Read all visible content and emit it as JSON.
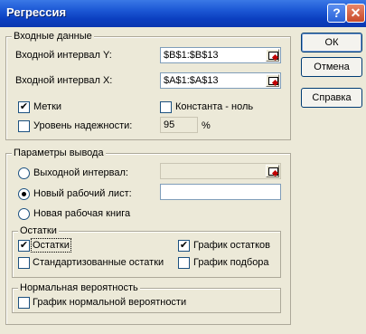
{
  "window": {
    "title": "Регрессия",
    "help_icon": "?",
    "close_icon": "✕"
  },
  "input_group": {
    "title": "Входные данные",
    "y_range_label": "Входной интервал Y:",
    "y_range_value": "$B$1:$B$13",
    "x_range_label": "Входной интервал X:",
    "x_range_value": "$A$1:$A$13",
    "labels_label": "Метки",
    "labels_checked": "✔",
    "constant_zero_label": "Константа - ноль",
    "confidence_label": "Уровень надежности:",
    "confidence_value": "95",
    "percent_sign": "%"
  },
  "output_group": {
    "title": "Параметры вывода",
    "output_range_label": "Выходной интервал:",
    "new_sheet_label": "Новый рабочий лист:",
    "new_workbook_label": "Новая рабочая книга"
  },
  "residuals_group": {
    "title": "Остатки",
    "residuals_label": "Остатки",
    "residuals_checked": "✔",
    "standardized_label": "Стандартизованные остатки",
    "residual_plots_label": "График остатков",
    "residual_plots_checked": "✔",
    "line_fit_label": "График подбора"
  },
  "normal_group": {
    "title": "Нормальная вероятность",
    "normal_plot_label": "График нормальной вероятности"
  },
  "buttons": {
    "ok": "ОК",
    "cancel": "Отмена",
    "help": "Справка"
  }
}
